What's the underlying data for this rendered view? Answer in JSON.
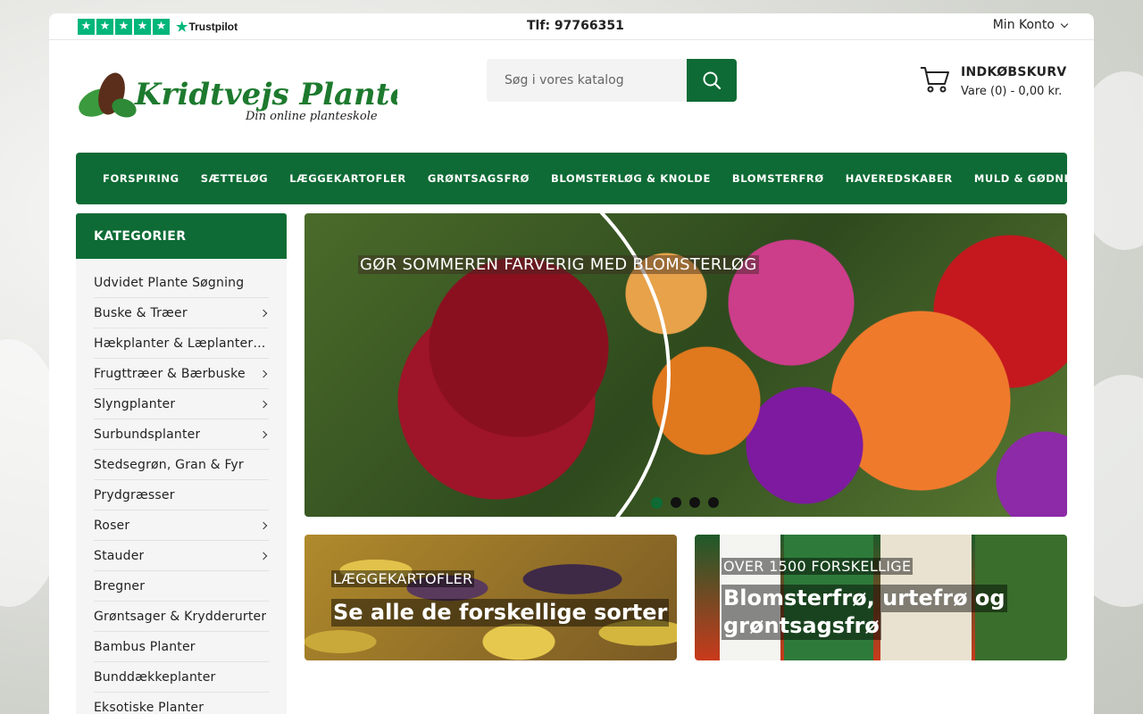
{
  "topbar": {
    "trustpilot_label": "Trustpilot",
    "phone": "Tlf: 97766351",
    "account_label": "Min Konto"
  },
  "header": {
    "logo_title": "Kridtvejs Planter",
    "logo_tagline": "Din online planteskole",
    "search_placeholder": "Søg i vores katalog",
    "cart_title": "INDKØBSKURV",
    "cart_summary": "Vare (0) - 0,00 kr."
  },
  "nav": {
    "items": [
      {
        "label": "FORSPIRING"
      },
      {
        "label": "SÆTTELØG"
      },
      {
        "label": "LÆGGEKARTOFLER"
      },
      {
        "label": "GRØNTSAGSFRØ"
      },
      {
        "label": "BLOMSTERLØG & KNOLDE"
      },
      {
        "label": "BLOMSTERFRØ"
      },
      {
        "label": "HAVEREDSKABER"
      },
      {
        "label": "MULD & GØDNING"
      }
    ]
  },
  "sidebar": {
    "heading": "KATEGORIER",
    "items": [
      {
        "label": "Udvidet Plante Søgning",
        "has_sub": false
      },
      {
        "label": "Buske & Træer",
        "has_sub": true
      },
      {
        "label": "Hækplanter & Læplanter (...",
        "has_sub": false
      },
      {
        "label": "Frugttræer & Bærbuske",
        "has_sub": true
      },
      {
        "label": "Slyngplanter",
        "has_sub": true
      },
      {
        "label": "Surbundsplanter",
        "has_sub": true
      },
      {
        "label": "Stedsegrøn, Gran & Fyr",
        "has_sub": false
      },
      {
        "label": "Prydgræsser",
        "has_sub": false
      },
      {
        "label": "Roser",
        "has_sub": true
      },
      {
        "label": "Stauder",
        "has_sub": true
      },
      {
        "label": "Bregner",
        "has_sub": false
      },
      {
        "label": "Grøntsager & Krydderurter",
        "has_sub": true
      },
      {
        "label": "Bambus Planter",
        "has_sub": false
      },
      {
        "label": "Bunddækkeplanter",
        "has_sub": false
      },
      {
        "label": "Eksotiske Planter",
        "has_sub": false
      }
    ]
  },
  "hero": {
    "caption": "GØR SOMMEREN FARVERIG MED BLOMSTERLØG",
    "slide_count": 4,
    "active_slide": 1
  },
  "banners": [
    {
      "small": "LÆGGEKARTOFLER",
      "big": "Se alle de forskellige sorter"
    },
    {
      "small": "OVER 1500 FORSKELLIGE",
      "big_line1": "Blomsterfrø, urtefrø og",
      "big_line2": "grøntsagsfrø"
    }
  ],
  "colors": {
    "brand_green": "#0e6b35",
    "trustpilot_green": "#00b67a"
  }
}
